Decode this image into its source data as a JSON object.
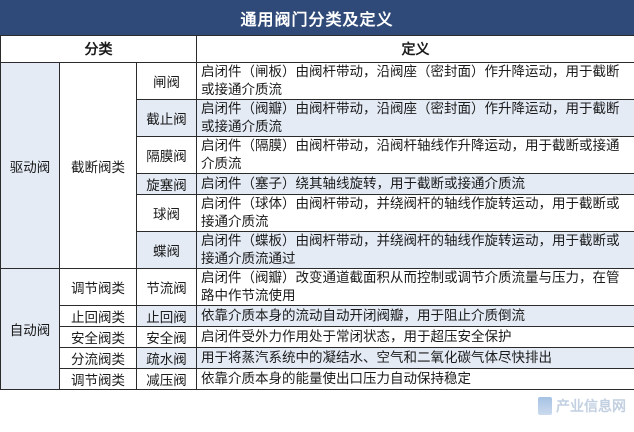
{
  "title": "通用阀门分类及定义",
  "headers": {
    "category": "分类",
    "definition": "定义"
  },
  "groups": {
    "drive": "驱动阀",
    "auto": "自动阀",
    "cutoff": "截断阀类",
    "regulate": "调节阀类",
    "check": "止回阀类",
    "safety": "安全阀类",
    "divert": "分流阀类",
    "regulate2": "调节阀类"
  },
  "rows": [
    {
      "name": "闸阀",
      "def": "启闭件（闸板）由阀杆带动，沿阀座（密封面）作升降运动，用于截断或接通介质流"
    },
    {
      "name": "截止阀",
      "def": "启闭件（阀瓣）由阀杆带动，沿阀座（密封面）作升降运动，用于截断或接通介质流"
    },
    {
      "name": "隔膜阀",
      "def": "启闭件（隔膜）由阀杆带动，沿阀杆轴线作升降运动，用于截断或接通介质流"
    },
    {
      "name": "旋塞阀",
      "def": "启闭件（塞子）绕其轴线旋转，用于截断或接通介质流"
    },
    {
      "name": "球阀",
      "def": "启闭件（球体）由阀杆带动，并绕阀杆的轴线作旋转运动，用于截断或接通介质流"
    },
    {
      "name": "蝶阀",
      "def": "启闭件（蝶板）由阀杆带动，并绕阀杆的轴线作旋转运动，用于截断或接通介质流通过"
    },
    {
      "name": "节流阀",
      "def": "启闭件（阀瓣）改变通道截面积从而控制或调节介质流量与压力，在管路中作节流使用"
    },
    {
      "name": "止回阀",
      "def": "依靠介质本身的流动自动开闭阀瓣，用于阻止介质倒流"
    },
    {
      "name": "安全阀",
      "def": "启闭件受外力作用处于常闭状态，用于超压安全保护"
    },
    {
      "name": "疏水阀",
      "def": "用于将蒸汽系统中的凝结水、空气和二氧化碳气体尽快排出"
    },
    {
      "name": "减压阀",
      "def": "依靠介质本身的能量使出口压力自动保持稳定"
    }
  ],
  "watermark": "产业信息网",
  "colors": {
    "title_bg": "#2f4a78",
    "shade": "#e4ebf5",
    "border": "#2b2b2b"
  }
}
